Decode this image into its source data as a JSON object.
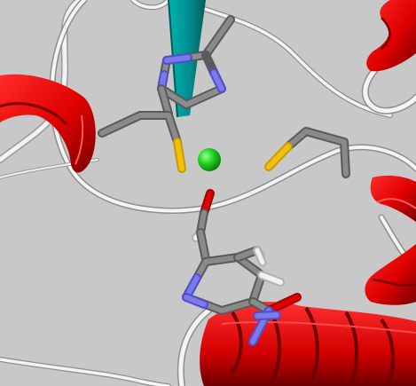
{
  "scene": {
    "background": "#c8c8c8",
    "colors": {
      "helix": "#e00000",
      "helix_dark": "#8a0000",
      "coil": "#f2f2f2",
      "coil_shade": "#9a9a9a",
      "strand": "#009898",
      "strand_dark": "#006464",
      "carbon": "#7a7a7a",
      "carbon_light": "#a8a8a8",
      "nitrogen": "#7a7ae8",
      "oxygen": "#e00000",
      "sulfur": "#f0c010",
      "hydrogen": "#f2f2f2",
      "metal_ion": "#1ed01e"
    },
    "objects": [
      {
        "name": "red-alpha-helix",
        "count_visible": 5
      },
      {
        "name": "white-coil-loop",
        "count_visible": 6
      },
      {
        "name": "teal-beta-strand",
        "count_visible": 1
      },
      {
        "name": "histidine-imidazole-sticks"
      },
      {
        "name": "cysteine-sticks",
        "count_visible": 2
      },
      {
        "name": "green-metal-ion",
        "count_visible": 1
      },
      {
        "name": "formyl-ligand-sticks"
      },
      {
        "name": "nitropyridine-ring-sticks"
      }
    ]
  }
}
